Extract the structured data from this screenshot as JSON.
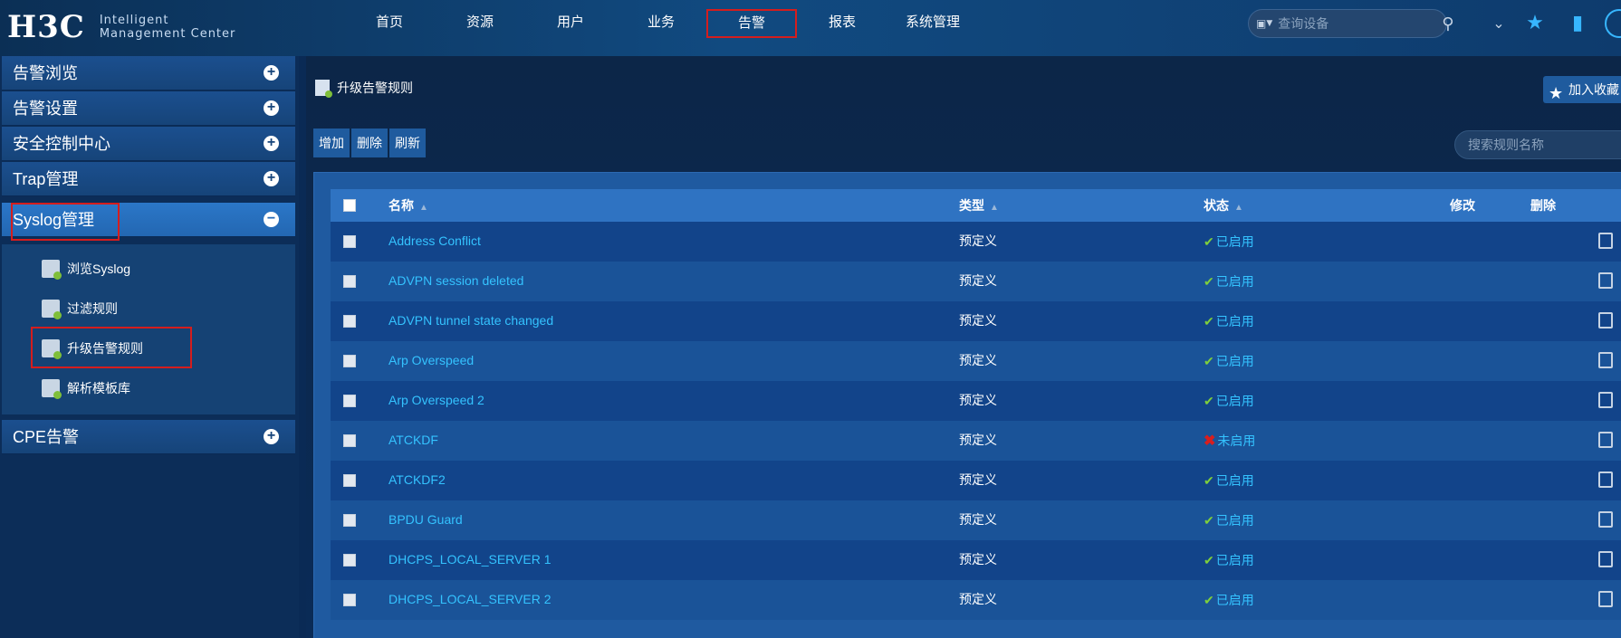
{
  "header": {
    "logo_h3c": "H3C",
    "logo_line1": "Intelligent",
    "logo_line2": "Management Center",
    "nav": [
      "首页",
      "资源",
      "用户",
      "业务",
      "告警",
      "报表",
      "系统管理"
    ],
    "active_nav_index": 4,
    "search_placeholder": "查询设备"
  },
  "sidebar": {
    "groups": [
      "告警浏览",
      "告警设置",
      "安全控制中心",
      "Trap管理",
      "Syslog管理",
      "CPE告警"
    ],
    "active_group": "Syslog管理",
    "syslog_items": [
      "浏览Syslog",
      "过滤规则",
      "升级告警规则",
      "解析模板库"
    ],
    "active_item": "升级告警规则"
  },
  "main": {
    "page_title": "升级告警规则",
    "favorite_label": "加入收藏",
    "toolbar": {
      "add": "增加",
      "delete": "删除",
      "refresh": "刷新"
    },
    "rule_search_placeholder": "搜索规则名称",
    "table": {
      "headers": {
        "name": "名称",
        "type": "类型",
        "state": "状态",
        "edit": "修改",
        "remove": "删除"
      },
      "rows": [
        {
          "name": "Address Conflict",
          "type": "预定义",
          "state": "已启用",
          "enabled": true
        },
        {
          "name": "ADVPN session deleted",
          "type": "预定义",
          "state": "已启用",
          "enabled": true
        },
        {
          "name": "ADVPN tunnel state changed",
          "type": "预定义",
          "state": "已启用",
          "enabled": true
        },
        {
          "name": "Arp Overspeed",
          "type": "预定义",
          "state": "已启用",
          "enabled": true
        },
        {
          "name": "Arp Overspeed 2",
          "type": "预定义",
          "state": "已启用",
          "enabled": true
        },
        {
          "name": "ATCKDF",
          "type": "预定义",
          "state": "未启用",
          "enabled": false
        },
        {
          "name": "ATCKDF2",
          "type": "预定义",
          "state": "已启用",
          "enabled": true
        },
        {
          "name": "BPDU Guard",
          "type": "预定义",
          "state": "已启用",
          "enabled": true
        },
        {
          "name": "DHCPS_LOCAL_SERVER 1",
          "type": "预定义",
          "state": "已启用",
          "enabled": true
        },
        {
          "name": "DHCPS_LOCAL_SERVER 2",
          "type": "预定义",
          "state": "已启用",
          "enabled": true
        }
      ]
    }
  },
  "colors": {
    "accent_red": "#d51d1d",
    "link_blue": "#34c3ff",
    "ok_green": "#7fd03b"
  }
}
